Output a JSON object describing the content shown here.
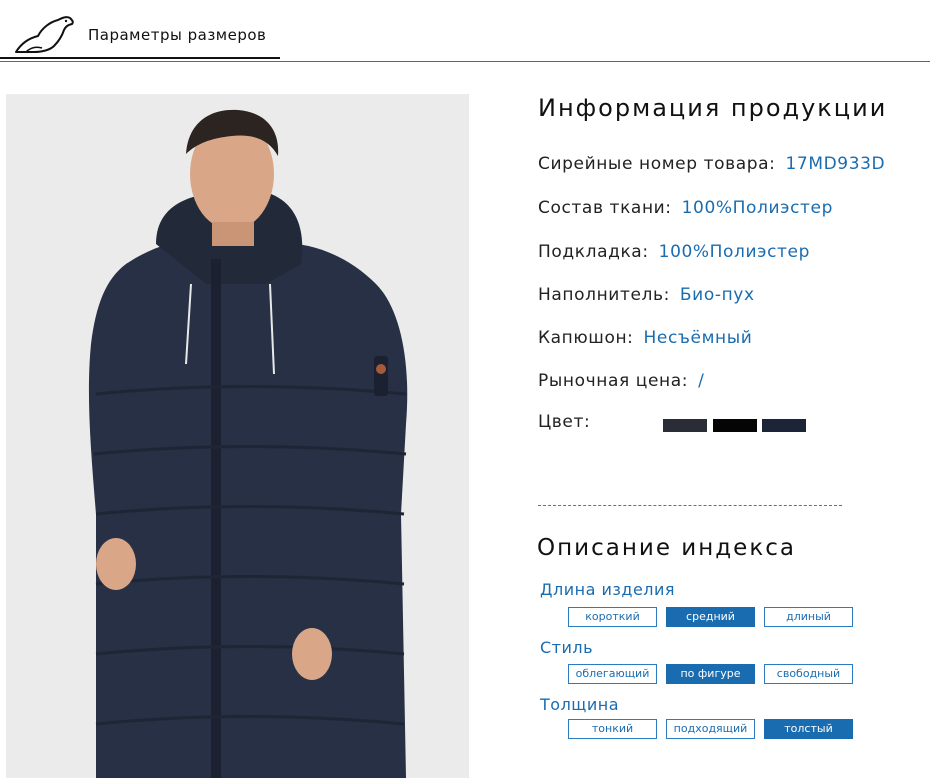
{
  "header": {
    "title": "Параметры размеров",
    "logo_icon": "polar-bear-logo-icon"
  },
  "photo": {
    "description_icon": "product-photo-man-in-hooded-parka"
  },
  "info": {
    "title": "Информация продукции",
    "rows": [
      {
        "label": "Сирейные номер товара:",
        "value": "17MD933D"
      },
      {
        "label": "Состав ткани:",
        "value": "100%Полиэстер"
      },
      {
        "label": "Подкладка:",
        "value": "100%Полиэстер"
      },
      {
        "label": "Наполнитель:",
        "value": "Био-пух"
      },
      {
        "label": "Капюшон:",
        "value": "Несъёмный"
      },
      {
        "label": "Рыночная цена:",
        "value": "/"
      }
    ],
    "color_label": "Цвет:",
    "swatches": [
      "#2a2c36",
      "#050505",
      "#1c2438"
    ]
  },
  "index": {
    "title": "Описание индекса",
    "groups": [
      {
        "label": "Длина изделия",
        "options": [
          "короткий",
          "средний",
          "длиный"
        ],
        "selected": "средний"
      },
      {
        "label": "Стиль",
        "options": [
          "облегающий",
          "по фигуре",
          "свободный"
        ],
        "selected": "по фигуре"
      },
      {
        "label": "Толщина",
        "options": [
          "тонкий",
          "подходящий",
          "толстый"
        ],
        "selected": "толстый"
      }
    ]
  },
  "colors": {
    "accent": "#1a6cb0",
    "text": "#222222",
    "photo_bg": "#ebebeb",
    "jacket": "#273044"
  }
}
